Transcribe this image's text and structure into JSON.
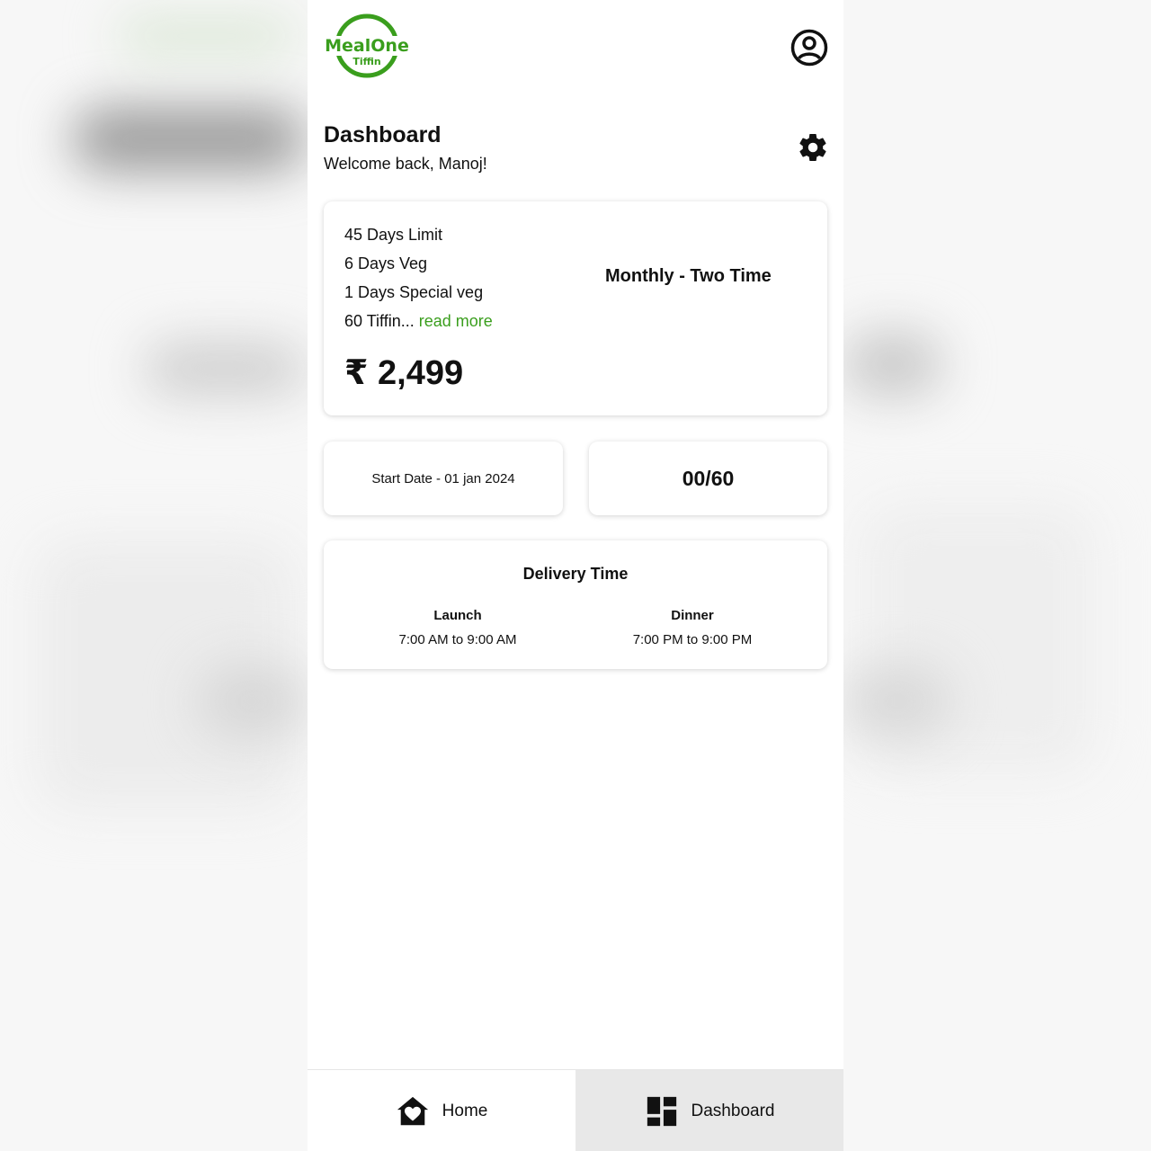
{
  "app": {
    "logo_text": "MealOne",
    "logo_subtext": "Tiffin",
    "brand_color": "#3a9e1d"
  },
  "header": {
    "profile_icon": "account-circle-icon",
    "settings_icon": "gear-icon"
  },
  "page": {
    "title": "Dashboard",
    "welcome": "Welcome back, Manoj!"
  },
  "plan": {
    "features": [
      "45 Days Limit",
      "6 Days Veg",
      "1 Days Special veg",
      "60 Tiffin..."
    ],
    "read_more": "read more",
    "price": "₹ 2,499",
    "name": "Monthly - Two Time"
  },
  "subscription": {
    "start_date": "Start Date - 01 jan 2024",
    "tiffin_count": "00/60"
  },
  "delivery": {
    "title": "Delivery Time",
    "slots": [
      {
        "name": "Launch",
        "time": "7:00 AM to 9:00 AM"
      },
      {
        "name": "Dinner",
        "time": "7:00 PM to 9:00 PM"
      }
    ]
  },
  "nav": {
    "items": [
      {
        "label": "Home",
        "icon": "home-heart-icon"
      },
      {
        "label": "Dashboard",
        "icon": "dashboard-icon"
      }
    ]
  }
}
